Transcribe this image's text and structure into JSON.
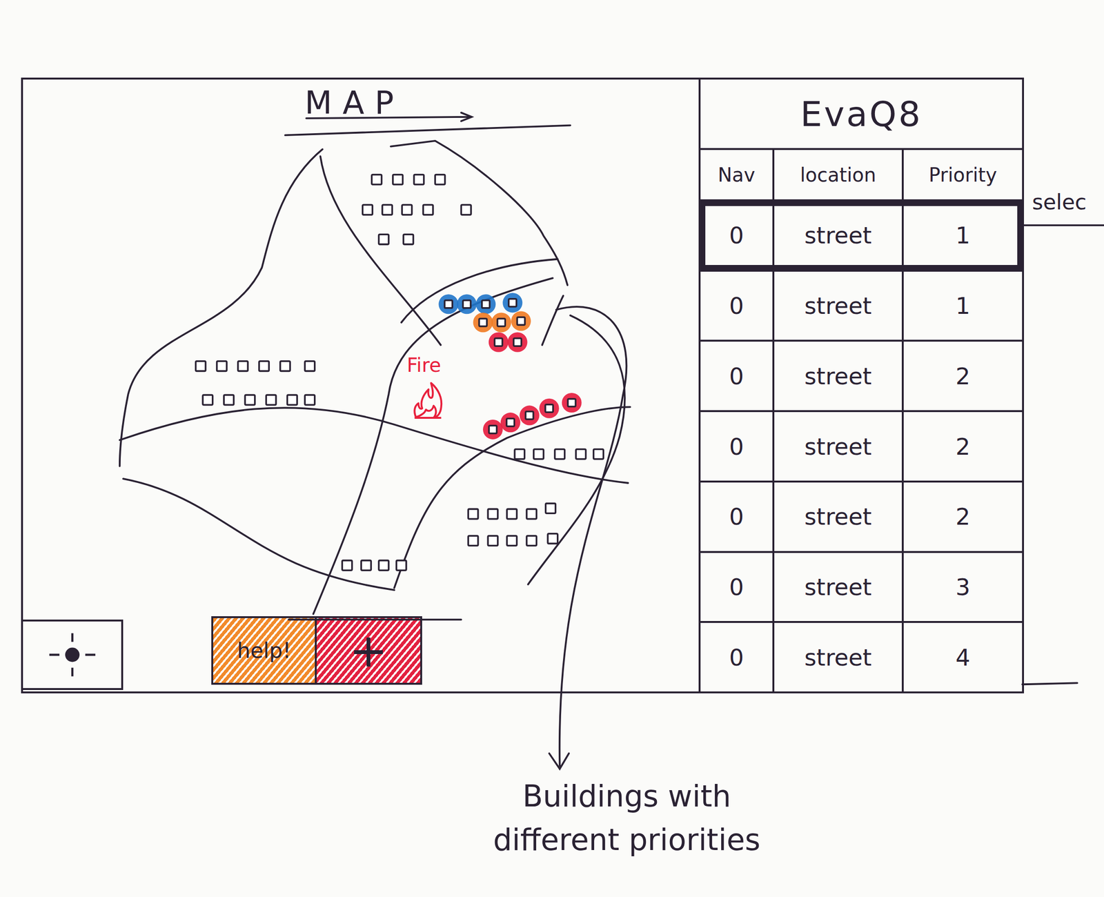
{
  "map": {
    "title": "MAP",
    "fire_label": "Fire",
    "highlighted_buildings": [
      {
        "color": "#1f74c9"
      },
      {
        "color": "#1f74c9"
      },
      {
        "color": "#1f74c9"
      },
      {
        "color": "#1f74c9"
      },
      {
        "color": "#f07a22"
      },
      {
        "color": "#f07a22"
      },
      {
        "color": "#f07a22"
      },
      {
        "color": "#e6193c"
      },
      {
        "color": "#e6193c"
      },
      {
        "color": "#e6193c"
      },
      {
        "color": "#e6193c"
      },
      {
        "color": "#e6193c"
      },
      {
        "color": "#e6193c"
      },
      {
        "color": "#e6193c"
      }
    ],
    "buttons": [
      {
        "label": "help!",
        "color": "#f28a2a"
      },
      {
        "label": "+",
        "color": "#e3213f"
      }
    ]
  },
  "panel": {
    "title": "EvaQ8",
    "columns": [
      "Nav",
      "location",
      "Priority"
    ],
    "rows": [
      {
        "nav": "0",
        "location": "street",
        "priority": "1",
        "selected": true
      },
      {
        "nav": "0",
        "location": "street",
        "priority": "1",
        "selected": false
      },
      {
        "nav": "0",
        "location": "street",
        "priority": "2",
        "selected": false
      },
      {
        "nav": "0",
        "location": "street",
        "priority": "2",
        "selected": false
      },
      {
        "nav": "0",
        "location": "street",
        "priority": "2",
        "selected": false
      },
      {
        "nav": "0",
        "location": "street",
        "priority": "3",
        "selected": false
      },
      {
        "nav": "0",
        "location": "street",
        "priority": "4",
        "selected": false
      }
    ]
  },
  "annotations": {
    "selected_note": "selec",
    "buildings_note": [
      "Buildings with",
      "different priorities"
    ]
  }
}
